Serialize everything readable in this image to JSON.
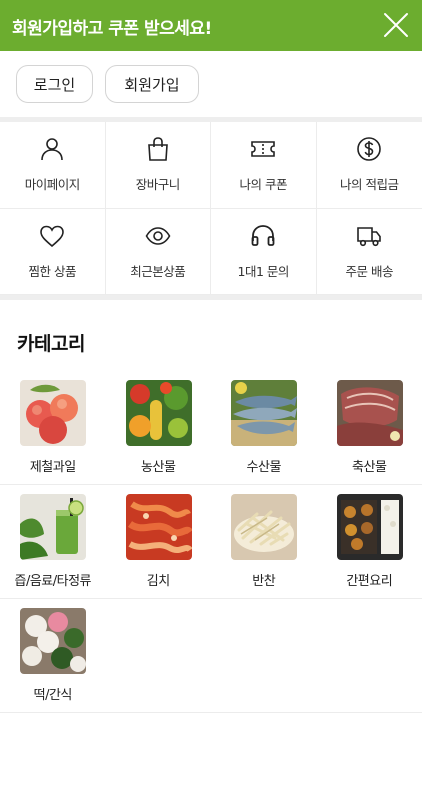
{
  "banner": {
    "text": "회원가입하고 쿠폰 받으세요!",
    "close_icon": "close-icon",
    "color": "#6cad2f"
  },
  "auth": {
    "login_label": "로그인",
    "join_label": "회원가입"
  },
  "menu": [
    {
      "label": "마이페이지",
      "icon": "person-icon"
    },
    {
      "label": "장바구니",
      "icon": "shopping-bag-icon"
    },
    {
      "label": "나의 쿠폰",
      "icon": "coupon-icon"
    },
    {
      "label": "나의 적립금",
      "icon": "dollar-coin-icon"
    },
    {
      "label": "찜한 상품",
      "icon": "heart-icon"
    },
    {
      "label": "최근본상품",
      "icon": "eye-icon"
    },
    {
      "label": "1대1 문의",
      "icon": "headset-icon"
    },
    {
      "label": "주문 배송",
      "icon": "truck-icon"
    }
  ],
  "category": {
    "title": "카테고리",
    "items": [
      {
        "label": "제철과일",
        "image": "peaches-image"
      },
      {
        "label": "농산물",
        "image": "vegetables-image"
      },
      {
        "label": "수산물",
        "image": "fish-image"
      },
      {
        "label": "축산물",
        "image": "meat-image"
      },
      {
        "label": "즙/음료/타정류",
        "image": "green-juice-image"
      },
      {
        "label": "김치",
        "image": "kimchi-image"
      },
      {
        "label": "반찬",
        "image": "side-dish-image"
      },
      {
        "label": "간편요리",
        "image": "meal-box-image"
      },
      {
        "label": "떡/간식",
        "image": "rice-cake-image"
      }
    ]
  }
}
